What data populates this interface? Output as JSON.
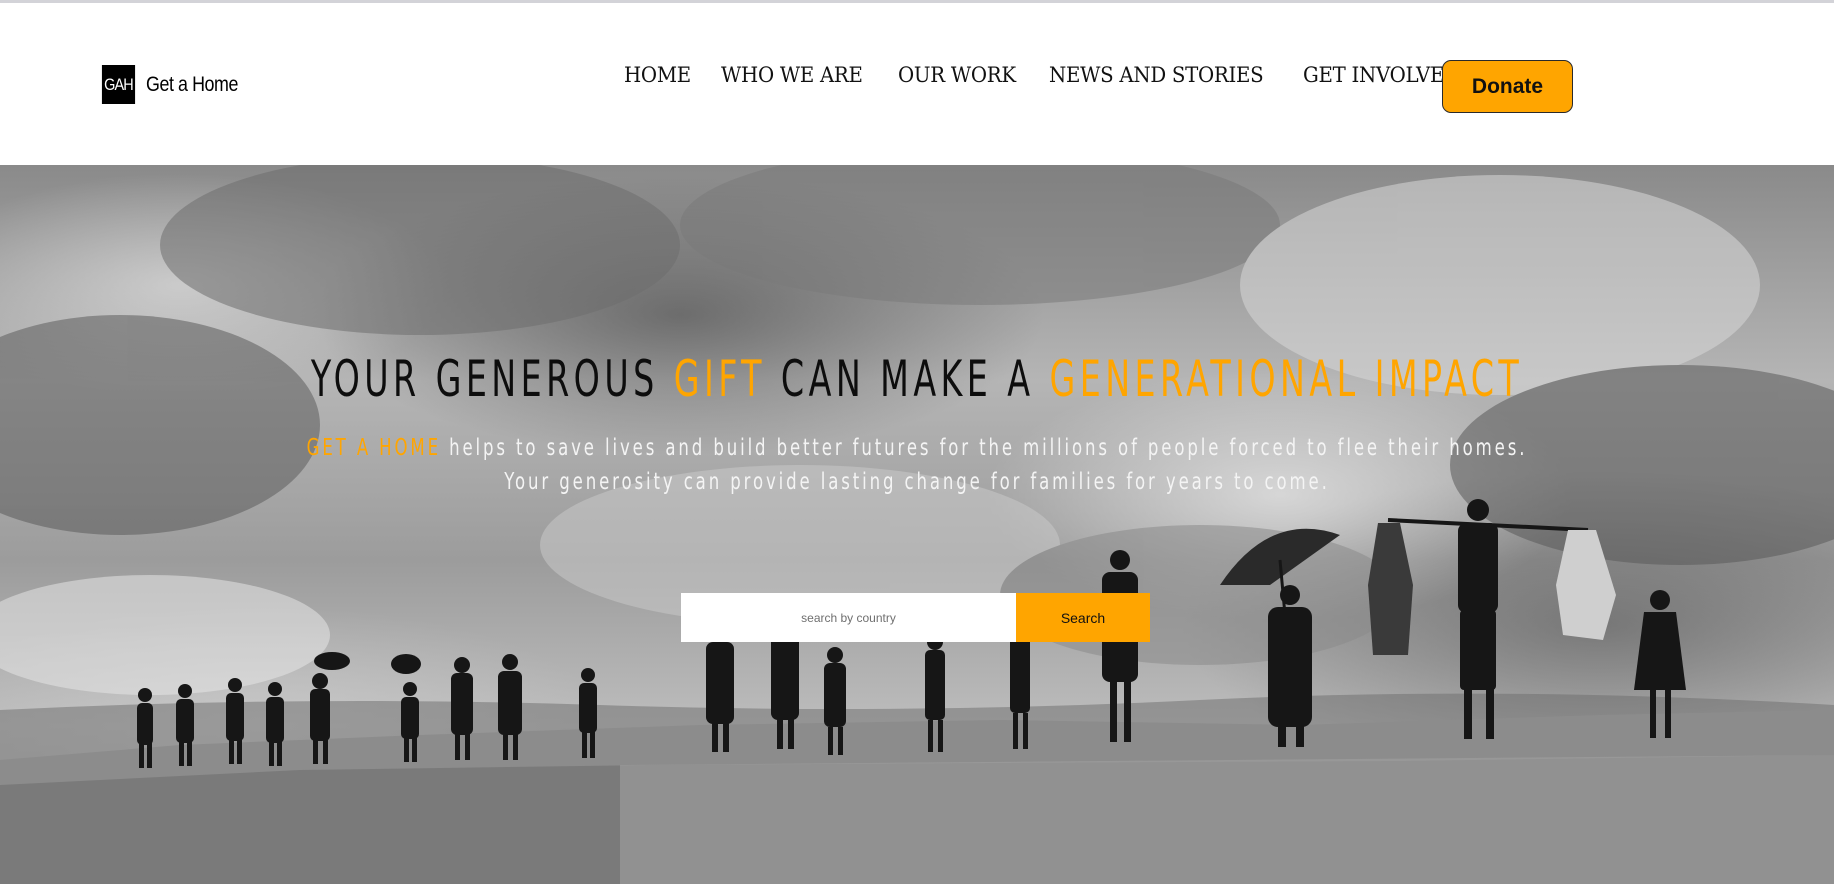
{
  "logo": {
    "mark": "GAH",
    "name": "Get a Home"
  },
  "nav": {
    "items": [
      {
        "label": "HOME"
      },
      {
        "label": "WHO WE ARE"
      },
      {
        "label": "OUR WORK"
      },
      {
        "label": "NEWS AND STORIES"
      },
      {
        "label": "GET INVOLVED"
      }
    ],
    "donate_label": "Donate"
  },
  "hero": {
    "headline_part1": "YOUR GENEROUS ",
    "headline_accent1": "GIFT",
    "headline_part2": " CAN MAKE A ",
    "headline_accent2": "GENERATIONAL IMPACT",
    "sub_accent": "GET A HOME",
    "sub_line1_rest": " helps to save lives and build better futures for the millions of people forced to flee their homes.",
    "sub_line2": "Your generosity can provide lasting change for families for years to come."
  },
  "search": {
    "placeholder": "search by country",
    "value": "",
    "button_label": "Search"
  },
  "colors": {
    "accent": "#ffa500",
    "text_dark": "#0d0d0d",
    "text_light": "#f4f4f4"
  },
  "icons": {
    "logo": "gah-logo-icon"
  }
}
